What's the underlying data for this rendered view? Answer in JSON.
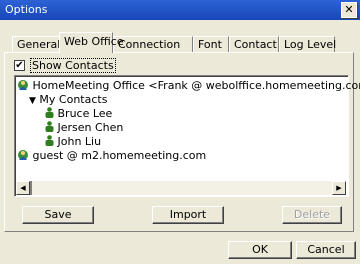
{
  "window": {
    "title": "Options",
    "close_label": "✕"
  },
  "tabs": [
    {
      "label": "General"
    },
    {
      "label": "Web Office"
    },
    {
      "label": "Connection"
    },
    {
      "label": "Font"
    },
    {
      "label": "Contact"
    },
    {
      "label": "Log Level"
    }
  ],
  "show_contacts": {
    "label": "Show Contacts",
    "checked": true,
    "mark": "✔"
  },
  "tree": {
    "root": "HomeMeeting Office <Frank @ webolffice.homemeeting.com>",
    "group": "My Contacts",
    "contacts": [
      "Bruce Lee",
      "Jersen Chen",
      "John Liu"
    ],
    "guest": "guest @ m2.homemeeting.com"
  },
  "buttons": {
    "save": "Save",
    "import": "Import",
    "delete": "Delete",
    "ok": "OK",
    "cancel": "Cancel"
  },
  "colors": {
    "titlebar": "#1f52c8",
    "face": "#ece9d8",
    "person_icon": "#2e7d1e"
  }
}
